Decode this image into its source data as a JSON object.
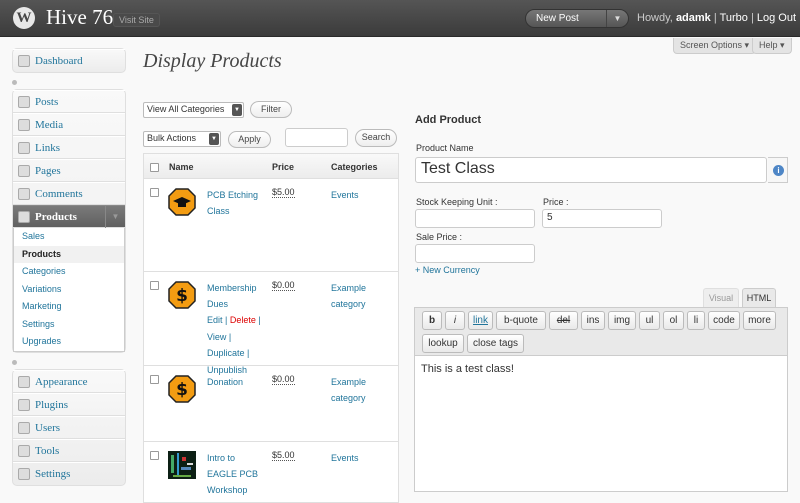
{
  "topbar": {
    "logo": "W",
    "site_title": "Hive 76",
    "visit_site": "Visit Site",
    "new_post": "New Post",
    "howdy": "Howdy,",
    "username": "adamk",
    "turbo": "Turbo",
    "logout": "Log Out",
    "sep": "|"
  },
  "screen_options": "Screen Options ▾",
  "help": "Help ▾",
  "menu": {
    "dashboard": "Dashboard",
    "posts": "Posts",
    "media": "Media",
    "links": "Links",
    "pages": "Pages",
    "comments": "Comments",
    "products": "Products",
    "sub": [
      "Sales",
      "Products",
      "Categories",
      "Variations",
      "Marketing",
      "Settings",
      "Upgrades"
    ],
    "appearance": "Appearance",
    "plugins": "Plugins",
    "users": "Users",
    "tools": "Tools",
    "settings": "Settings"
  },
  "page_title": "Display Products",
  "filters": {
    "category_select": "View All Categories",
    "filter_btn": "Filter",
    "bulk_select": "Bulk Actions",
    "apply_btn": "Apply",
    "search_value": "",
    "search_btn": "Search"
  },
  "table": {
    "headers": {
      "name": "Name",
      "price": "Price",
      "categories": "Categories"
    },
    "rows": [
      {
        "name": "PCB Etching Class",
        "price": "$5.00",
        "category": "Events",
        "icon": "mortarboard-hex"
      },
      {
        "name": "Membership Dues",
        "price": "$0.00",
        "category": "Example category",
        "icon": "dollar-hex",
        "actions": {
          "edit": "Edit",
          "delete": "Delete",
          "view": "View",
          "duplicate": "Duplicate",
          "unpublish": "Unpublish",
          "sep": "|"
        }
      },
      {
        "name": "Donation",
        "price": "$0.00",
        "category": "Example category",
        "icon": "dollar-hex"
      },
      {
        "name": "Intro to EAGLE PCB Workshop",
        "price": "$5.00",
        "category": "Events",
        "icon": "pcb-photo"
      }
    ]
  },
  "add_product": {
    "title": "Add Product",
    "name_label": "Product Name",
    "name_value": "Test Class",
    "sku_label": "Stock Keeping Unit :",
    "sku_value": "",
    "price_label": "Price :",
    "price_value": "5",
    "sale_label": "Sale Price :",
    "sale_value": "",
    "new_currency": "+ New Currency",
    "tab_visual": "Visual",
    "tab_html": "HTML",
    "quicktags": [
      "b",
      "i",
      "link",
      "b-quote",
      "del",
      "ins",
      "img",
      "ul",
      "ol",
      "li",
      "code",
      "more",
      "lookup",
      "close tags"
    ],
    "content": "This is a test class!"
  }
}
